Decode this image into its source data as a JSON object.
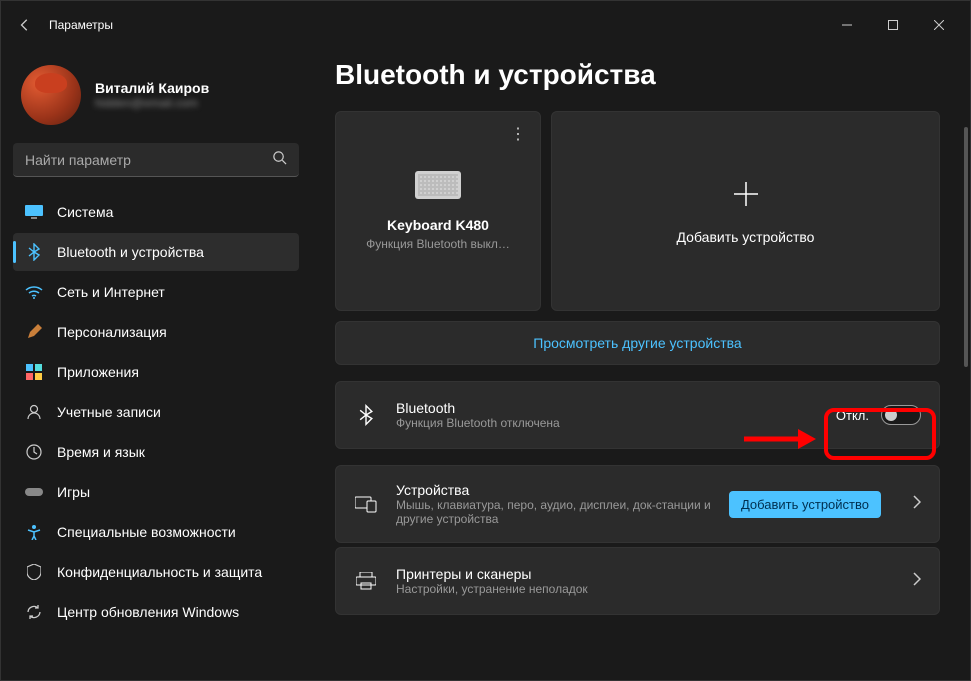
{
  "window": {
    "title": "Параметры"
  },
  "profile": {
    "name": "Виталий Каиров",
    "email": "hidden@email.com"
  },
  "search": {
    "placeholder": "Найти параметр"
  },
  "nav": [
    {
      "id": "system",
      "label": "Система"
    },
    {
      "id": "bluetooth",
      "label": "Bluetooth и устройства",
      "active": true
    },
    {
      "id": "network",
      "label": "Сеть и Интернет"
    },
    {
      "id": "personalization",
      "label": "Персонализация"
    },
    {
      "id": "apps",
      "label": "Приложения"
    },
    {
      "id": "accounts",
      "label": "Учетные записи"
    },
    {
      "id": "time",
      "label": "Время и язык"
    },
    {
      "id": "gaming",
      "label": "Игры"
    },
    {
      "id": "accessibility",
      "label": "Специальные возможности"
    },
    {
      "id": "privacy",
      "label": "Конфиденциальность и защита"
    },
    {
      "id": "update",
      "label": "Центр обновления Windows"
    }
  ],
  "page": {
    "title": "Bluetooth и устройства"
  },
  "deviceCard": {
    "title": "Keyboard K480",
    "subtitle": "Функция Bluetooth выкл…"
  },
  "addCard": {
    "label": "Добавить устройство"
  },
  "viewMore": {
    "label": "Просмотреть другие устройства"
  },
  "rows": {
    "bluetooth": {
      "title": "Bluetooth",
      "subtitle": "Функция Bluetooth отключена",
      "toggleLabel": "Откл."
    },
    "devices": {
      "title": "Устройства",
      "subtitle": "Мышь, клавиатура, перо, аудио, дисплеи, док-станции и другие устройства",
      "button": "Добавить устройство"
    },
    "printers": {
      "title": "Принтеры и сканеры",
      "subtitle": "Настройки, устранение неполадок"
    }
  }
}
